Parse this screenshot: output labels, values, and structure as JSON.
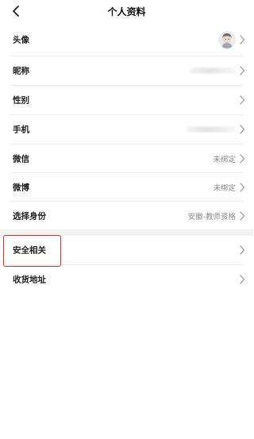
{
  "header": {
    "title": "个人资料",
    "back_icon": "chevron-left-icon"
  },
  "rows": [
    {
      "label": "头像",
      "value": "",
      "icon": "avatar-icon"
    },
    {
      "label": "昵称",
      "value": ""
    },
    {
      "label": "性别",
      "value": ""
    },
    {
      "label": "手机",
      "value": ""
    },
    {
      "label": "微信",
      "value": "未绑定"
    },
    {
      "label": "微博",
      "value": "未绑定"
    },
    {
      "label": "选择身份",
      "value": "安徽-教师资格"
    },
    {
      "label": "安全相关",
      "value": ""
    },
    {
      "label": "收货地址",
      "value": ""
    }
  ],
  "colors": {
    "highlight_border": "#d62b2b",
    "section_gap": "#f2f2f2",
    "value_text": "#8a8a8a",
    "chevron": "#9a9a9a"
  }
}
